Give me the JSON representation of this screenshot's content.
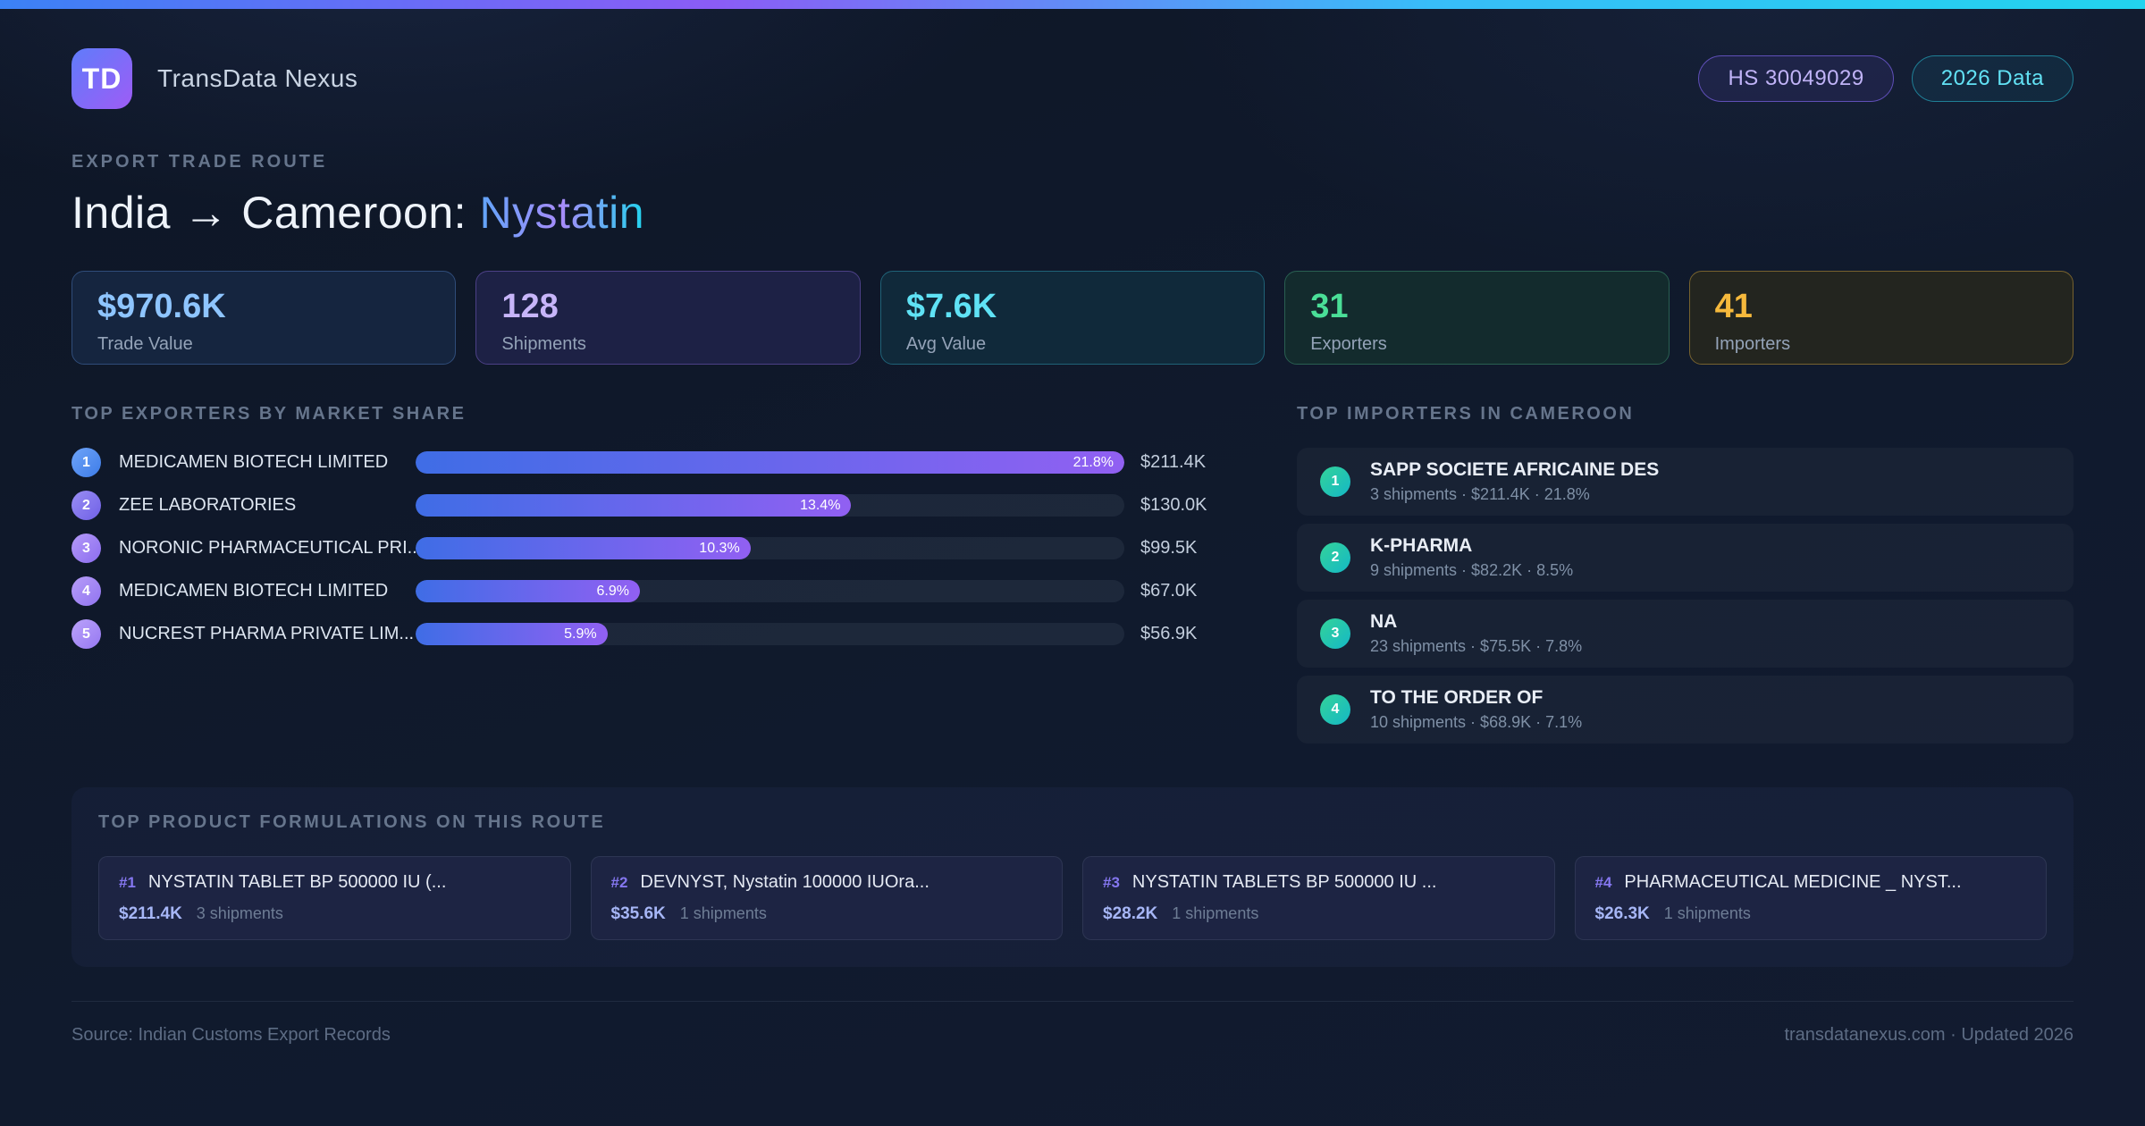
{
  "app": {
    "logo_text": "TD",
    "name": "TransData Nexus",
    "badges": [
      {
        "label": "HS 30049029",
        "text": "#c0b3f7",
        "border": "#5f4fb8",
        "bg": "rgba(124,92,246,0.10)"
      },
      {
        "label": "2026 Data",
        "text": "#62e1f4",
        "border": "#1f7f96",
        "bg": "rgba(34,211,238,0.07)"
      }
    ]
  },
  "header": {
    "eyebrow": "EXPORT TRADE ROUTE",
    "title_main": "India → Cameroon: ",
    "title_accent": "Nystatin"
  },
  "stats": [
    {
      "value": "$970.6K",
      "label": "Trade Value",
      "accent": "#8ec5ff",
      "border": "#2f4c79",
      "bg": "#15253f"
    },
    {
      "value": "128",
      "label": "Shipments",
      "accent": "#c7b5f9",
      "border": "#4c4086",
      "bg": "#1d2145"
    },
    {
      "value": "$7.6K",
      "label": "Avg Value",
      "accent": "#5fe2f5",
      "border": "#1f6277",
      "bg": "#10293a"
    },
    {
      "value": "31",
      "label": "Exporters",
      "accent": "#4ade97",
      "border": "#295f51",
      "bg": "#132b2d"
    },
    {
      "value": "41",
      "label": "Importers",
      "accent": "#f6b93c",
      "border": "#77622e",
      "bg": "#23251f"
    }
  ],
  "exporters": {
    "heading": "TOP EXPORTERS BY MARKET SHARE",
    "max_share_pct": 21.8,
    "rows": [
      {
        "rank": "1",
        "name": "MEDICAMEN BIOTECH LIMITED",
        "share_pct": 21.8,
        "share_label": "21.8%",
        "value": "$211.4K"
      },
      {
        "rank": "2",
        "name": "ZEE LABORATORIES",
        "share_pct": 13.4,
        "share_label": "13.4%",
        "value": "$130.0K"
      },
      {
        "rank": "3",
        "name": "NORONIC PHARMACEUTICAL PRI...",
        "share_pct": 10.3,
        "share_label": "10.3%",
        "value": "$99.5K"
      },
      {
        "rank": "4",
        "name": "MEDICAMEN BIOTECH LIMITED",
        "share_pct": 6.9,
        "share_label": "6.9%",
        "value": "$67.0K"
      },
      {
        "rank": "5",
        "name": "NUCREST PHARMA PRIVATE LIM...",
        "share_pct": 5.9,
        "share_label": "5.9%",
        "value": "$56.9K"
      }
    ]
  },
  "importers": {
    "heading": "TOP IMPORTERS IN CAMEROON",
    "rows": [
      {
        "rank": "1",
        "name": "SAPP SOCIETE AFRICAINE DES",
        "detail": "3 shipments · $211.4K · 21.8%"
      },
      {
        "rank": "2",
        "name": "K-PHARMA",
        "detail": "9 shipments · $82.2K · 8.5%"
      },
      {
        "rank": "3",
        "name": "NA",
        "detail": "23 shipments · $75.5K · 7.8%"
      },
      {
        "rank": "4",
        "name": "TO THE ORDER OF",
        "detail": "10 shipments · $68.9K · 7.1%"
      }
    ]
  },
  "products": {
    "heading": "TOP PRODUCT FORMULATIONS ON THIS ROUTE",
    "cards": [
      {
        "rank": "#1",
        "name": "NYSTATIN TABLET BP 500000 IU (...",
        "value": "$211.4K",
        "shipments": "3 shipments"
      },
      {
        "rank": "#2",
        "name": "DEVNYST, Nystatin 100000 IUOra...",
        "value": "$35.6K",
        "shipments": "1 shipments"
      },
      {
        "rank": "#3",
        "name": "NYSTATIN TABLETS BP 500000 IU ...",
        "value": "$28.2K",
        "shipments": "1 shipments"
      },
      {
        "rank": "#4",
        "name": "PHARMACEUTICAL MEDICINE _ NYST...",
        "value": "$26.3K",
        "shipments": "1 shipments"
      }
    ]
  },
  "footer": {
    "source": "Source: Indian Customs Export Records",
    "site": "transdatanexus.com · Updated 2026"
  },
  "colors": {
    "top_bar": [
      "#3b82f6",
      "#8b5cf6",
      "#38bdf8",
      "#22d3ee"
    ],
    "logo": {
      "from": "#5f7cfa",
      "to": "#9e5cf6"
    },
    "title_accent": [
      "#60a5fa",
      "#a78bfa",
      "#22d3ee"
    ],
    "bar": {
      "from": "#3f6de6",
      "to": "#9160f2"
    },
    "exporter_ranks": [
      {
        "from": "#6fa4f8",
        "to": "#3d7ce8"
      },
      {
        "from": "#9a8ef4",
        "to": "#6f60e6"
      },
      {
        "from": "#b49af8",
        "to": "#8b6cf0"
      },
      {
        "from": "#b79df8",
        "to": "#9174f0"
      },
      {
        "from": "#bba3fa",
        "to": "#9678f2"
      }
    ],
    "importer_rank": {
      "from": "#34d399",
      "to": "#14b8c6"
    }
  }
}
